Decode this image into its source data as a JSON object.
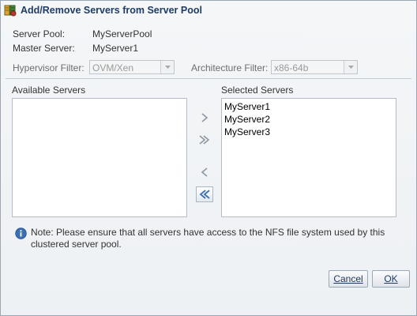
{
  "dialog": {
    "title": "Add/Remove Servers from Server Pool"
  },
  "info": {
    "server_pool_label": "Server Pool:",
    "server_pool_value": "MyServerPool",
    "master_server_label": "Master Server:",
    "master_server_value": "MyServer1"
  },
  "filters": {
    "hypervisor_label": "Hypervisor Filter:",
    "hypervisor_value": "OVM/Xen",
    "architecture_label": "Architecture Filter:",
    "architecture_value": "x86-64b"
  },
  "available": {
    "label": "Available Servers",
    "items": []
  },
  "selected": {
    "label": "Selected Servers",
    "items": [
      "MyServer1",
      "MyServer2",
      "MyServer3"
    ]
  },
  "shuttle_buttons": {
    "move": "move-right-icon",
    "move_all": "move-all-right-icon",
    "remove": "move-left-icon",
    "remove_all": "move-all-left-icon"
  },
  "note": {
    "text": "Note: Please ensure that all servers have access to the NFS file system used by this clustered server pool."
  },
  "buttons": {
    "cancel": "Cancel",
    "ok": "OK"
  },
  "colors": {
    "title": "#1f3c65",
    "background": "#eef1f4",
    "info_icon": "#3b6fb6"
  }
}
